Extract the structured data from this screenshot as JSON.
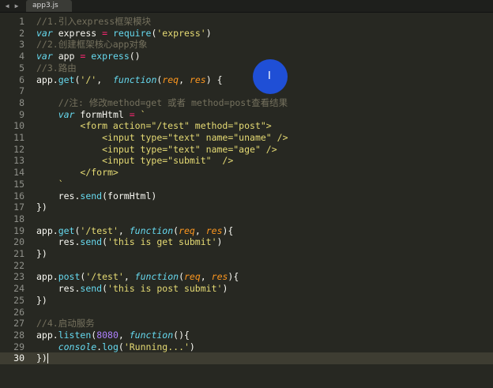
{
  "tabbar": {
    "back_glyph": "◀",
    "forward_glyph": "▶",
    "active_tab": "app3.js"
  },
  "editor": {
    "cursor_line": 30,
    "line_numbers": [
      "1",
      "2",
      "3",
      "4",
      "5",
      "6",
      "7",
      "8",
      "9",
      "10",
      "11",
      "12",
      "13",
      "14",
      "15",
      "16",
      "17",
      "18",
      "19",
      "20",
      "21",
      "22",
      "23",
      "24",
      "25",
      "26",
      "27",
      "28",
      "29",
      "30"
    ],
    "lines": [
      [
        {
          "t": "comment",
          "v": "//1.引入express框架模块"
        }
      ],
      [
        {
          "t": "kw",
          "v": "var"
        },
        {
          "t": "plain",
          "v": " express "
        },
        {
          "t": "op",
          "v": "="
        },
        {
          "t": "plain",
          "v": " "
        },
        {
          "t": "fn",
          "v": "require"
        },
        {
          "t": "plain",
          "v": "("
        },
        {
          "t": "str",
          "v": "'express'"
        },
        {
          "t": "plain",
          "v": ")"
        }
      ],
      [
        {
          "t": "comment",
          "v": "//2.创建框架核心app对象"
        }
      ],
      [
        {
          "t": "kw",
          "v": "var"
        },
        {
          "t": "plain",
          "v": " app "
        },
        {
          "t": "op",
          "v": "="
        },
        {
          "t": "plain",
          "v": " "
        },
        {
          "t": "fn",
          "v": "express"
        },
        {
          "t": "plain",
          "v": "()"
        }
      ],
      [
        {
          "t": "comment",
          "v": "//3.路由"
        }
      ],
      [
        {
          "t": "plain",
          "v": "app."
        },
        {
          "t": "fn",
          "v": "get"
        },
        {
          "t": "plain",
          "v": "("
        },
        {
          "t": "str",
          "v": "'/'"
        },
        {
          "t": "plain",
          "v": ",  "
        },
        {
          "t": "kw",
          "v": "function"
        },
        {
          "t": "plain",
          "v": "("
        },
        {
          "t": "param",
          "v": "req"
        },
        {
          "t": "plain",
          "v": ", "
        },
        {
          "t": "param",
          "v": "res"
        },
        {
          "t": "plain",
          "v": ") {"
        }
      ],
      [],
      [
        {
          "t": "plain",
          "v": "    "
        },
        {
          "t": "comment",
          "v": "//注: 修改method=get 或者 method=post查看结果"
        }
      ],
      [
        {
          "t": "plain",
          "v": "    "
        },
        {
          "t": "kw",
          "v": "var"
        },
        {
          "t": "plain",
          "v": " formHtml "
        },
        {
          "t": "op",
          "v": "="
        },
        {
          "t": "plain",
          "v": " "
        },
        {
          "t": "str",
          "v": "`"
        }
      ],
      [
        {
          "t": "plain",
          "v": "        "
        },
        {
          "t": "str",
          "v": "<form action=\"/test\" method=\"post\">"
        }
      ],
      [
        {
          "t": "plain",
          "v": "            "
        },
        {
          "t": "str",
          "v": "<input type=\"text\" name=\"uname\" />"
        }
      ],
      [
        {
          "t": "plain",
          "v": "            "
        },
        {
          "t": "str",
          "v": "<input type=\"text\" name=\"age\" />"
        }
      ],
      [
        {
          "t": "plain",
          "v": "            "
        },
        {
          "t": "str",
          "v": "<input type=\"submit\"  />"
        }
      ],
      [
        {
          "t": "plain",
          "v": "        "
        },
        {
          "t": "str",
          "v": "</form>"
        }
      ],
      [
        {
          "t": "plain",
          "v": "    "
        },
        {
          "t": "str",
          "v": "`"
        }
      ],
      [
        {
          "t": "plain",
          "v": "    res."
        },
        {
          "t": "fn",
          "v": "send"
        },
        {
          "t": "plain",
          "v": "(formHtml)"
        }
      ],
      [
        {
          "t": "plain",
          "v": "})"
        }
      ],
      [],
      [
        {
          "t": "plain",
          "v": "app."
        },
        {
          "t": "fn",
          "v": "get"
        },
        {
          "t": "plain",
          "v": "("
        },
        {
          "t": "str",
          "v": "'/test'"
        },
        {
          "t": "plain",
          "v": ", "
        },
        {
          "t": "kw",
          "v": "function"
        },
        {
          "t": "plain",
          "v": "("
        },
        {
          "t": "param",
          "v": "req"
        },
        {
          "t": "plain",
          "v": ", "
        },
        {
          "t": "param",
          "v": "res"
        },
        {
          "t": "plain",
          "v": "){"
        }
      ],
      [
        {
          "t": "plain",
          "v": "    res."
        },
        {
          "t": "fn",
          "v": "send"
        },
        {
          "t": "plain",
          "v": "("
        },
        {
          "t": "str",
          "v": "'this is get submit'"
        },
        {
          "t": "plain",
          "v": ")"
        }
      ],
      [
        {
          "t": "plain",
          "v": "})"
        }
      ],
      [],
      [
        {
          "t": "plain",
          "v": "app."
        },
        {
          "t": "fn",
          "v": "post"
        },
        {
          "t": "plain",
          "v": "("
        },
        {
          "t": "str",
          "v": "'/test'"
        },
        {
          "t": "plain",
          "v": ", "
        },
        {
          "t": "kw",
          "v": "function"
        },
        {
          "t": "plain",
          "v": "("
        },
        {
          "t": "param",
          "v": "req"
        },
        {
          "t": "plain",
          "v": ", "
        },
        {
          "t": "param",
          "v": "res"
        },
        {
          "t": "plain",
          "v": "){"
        }
      ],
      [
        {
          "t": "plain",
          "v": "    res."
        },
        {
          "t": "fn",
          "v": "send"
        },
        {
          "t": "plain",
          "v": "("
        },
        {
          "t": "str",
          "v": "'this is post submit'"
        },
        {
          "t": "plain",
          "v": ")"
        }
      ],
      [
        {
          "t": "plain",
          "v": "})"
        }
      ],
      [],
      [
        {
          "t": "comment",
          "v": "//4.启动服务"
        }
      ],
      [
        {
          "t": "plain",
          "v": "app."
        },
        {
          "t": "fn",
          "v": "listen"
        },
        {
          "t": "plain",
          "v": "("
        },
        {
          "t": "num",
          "v": "8080"
        },
        {
          "t": "plain",
          "v": ", "
        },
        {
          "t": "kw",
          "v": "function"
        },
        {
          "t": "plain",
          "v": "(){"
        }
      ],
      [
        {
          "t": "plain",
          "v": "    "
        },
        {
          "t": "kw",
          "v": "console"
        },
        {
          "t": "plain",
          "v": "."
        },
        {
          "t": "fn",
          "v": "log"
        },
        {
          "t": "plain",
          "v": "("
        },
        {
          "t": "str",
          "v": "'Running...'"
        },
        {
          "t": "plain",
          "v": ")"
        }
      ],
      [
        {
          "t": "plain",
          "v": "})"
        }
      ]
    ]
  },
  "overlay": {
    "pointer_icon": "text-cursor-icon",
    "ibeam_glyph": "I",
    "pointer_color": "#1f4fd6"
  },
  "theme": {
    "background": "#272822",
    "comment": "#75715e",
    "keyword": "#66d9ef",
    "string": "#e6db74",
    "param": "#fd971f"
  }
}
